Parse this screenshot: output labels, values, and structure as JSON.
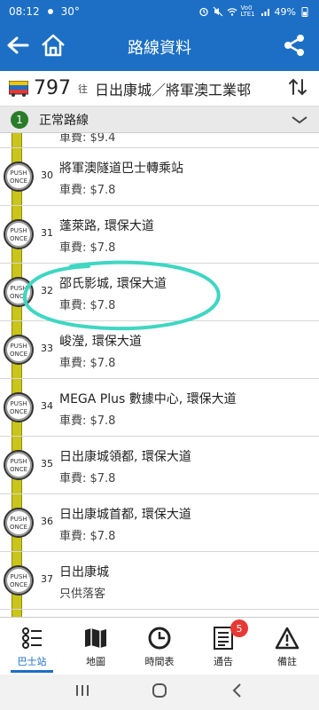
{
  "status_bar": {
    "time": "08:12",
    "temp": "30°",
    "battery": "49%",
    "net": "Vo0 LTE1"
  },
  "app_bar": {
    "title": "路線資料"
  },
  "route": {
    "number": "797",
    "to_label": "往",
    "destination": "日出康城／將軍澳工業邨"
  },
  "variant": {
    "badge": "1",
    "label": "正常路線"
  },
  "stops": [
    {
      "seq": "",
      "name": "",
      "fare": "車費: $9.4"
    },
    {
      "seq": "30",
      "name": "將軍澳隧道巴士轉乘站",
      "fare": "車費: $7.8"
    },
    {
      "seq": "31",
      "name": "蓬萊路, 環保大道",
      "fare": "車費: $7.8"
    },
    {
      "seq": "32",
      "name": "邵氏影城, 環保大道",
      "fare": "車費: $7.8"
    },
    {
      "seq": "33",
      "name": "峻瀅, 環保大道",
      "fare": "車費: $7.8"
    },
    {
      "seq": "34",
      "name": "MEGA Plus 數據中心, 環保大道",
      "fare": "車費: $7.8"
    },
    {
      "seq": "35",
      "name": "日出康城領都, 環保大道",
      "fare": "車費: $7.8"
    },
    {
      "seq": "36",
      "name": "日出康城首都, 環保大道",
      "fare": "車費: $7.8"
    },
    {
      "seq": "37",
      "name": "日出康城",
      "fare": "只供落客"
    }
  ],
  "push_text": {
    "top": "PUSH",
    "bottom": "ONCE"
  },
  "tabs": [
    {
      "label": "巴士站",
      "icon": "bus-stop-icon",
      "active": true
    },
    {
      "label": "地圖",
      "icon": "map-icon"
    },
    {
      "label": "時間表",
      "icon": "clock-icon"
    },
    {
      "label": "通告",
      "icon": "notice-icon",
      "badge": "5"
    },
    {
      "label": "備註",
      "icon": "warning-icon"
    }
  ],
  "colors": {
    "primary": "#1c6fc4",
    "route_line": "#c9c51a",
    "highlight": "#3fd6c2",
    "badge_red": "#e53935",
    "variant_green": "#2a7c2a"
  }
}
